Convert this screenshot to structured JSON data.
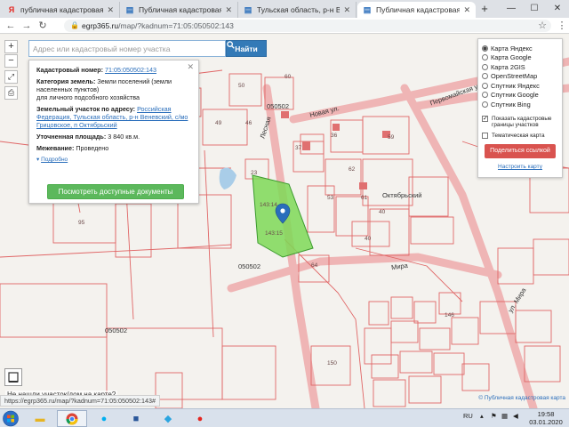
{
  "browser": {
    "tabs": [
      {
        "title": "публичная кадастровая карта т",
        "favicon": "Я",
        "favicon_color": "#e52620"
      },
      {
        "title": "Публичная кадастровая карта",
        "favicon": "▤",
        "favicon_color": "#2a6ebb"
      },
      {
        "title": "Тульская область, р-н Веневск",
        "favicon": "▤",
        "favicon_color": "#2a6ebb"
      },
      {
        "title": "Публичная кадастровая карта",
        "favicon": "▤",
        "favicon_color": "#2a6ebb"
      }
    ],
    "new_tab": "+",
    "url_host": "egrp365.ru",
    "url_path": "/map/?kadnum=71:05:050502:143"
  },
  "search": {
    "placeholder": "Адрес или кадастровый номер участка",
    "button_label": "Найти"
  },
  "zoom": {
    "in": "+",
    "out": "−"
  },
  "parcel": {
    "cadastral_label": "Кадастровый номер:",
    "cadastral_number": "71:05:050502:143",
    "category_label": "Категория земель:",
    "category_value": "Земли поселений (земли населенных пунктов)",
    "usage": "для личного подсобного хозяйства",
    "address_label": "Земельный участок по адресу:",
    "address_value": "Российская Федерация, Тульская область, р-н Веневский, с/мо Грицовское, п Октябрьский",
    "area_label": "Уточненная площадь:",
    "area_value": "3 840 кв.м.",
    "survey_label": "Межевание:",
    "survey_value": "Проведено",
    "more_link": "Подробно",
    "docs_button": "Посмотреть доступные документы"
  },
  "layers": {
    "options": [
      {
        "label": "Карта Яндекс",
        "selected": true
      },
      {
        "label": "Карта Google",
        "selected": false
      },
      {
        "label": "Карта 2GIS",
        "selected": false
      },
      {
        "label": "OpenStreetMap",
        "selected": false
      },
      {
        "label": "Спутник Яндекс",
        "selected": false
      },
      {
        "label": "Спутник Google",
        "selected": false
      },
      {
        "label": "Спутник Bing",
        "selected": false
      }
    ],
    "show_boundaries": "Показать кадастровые границы участков",
    "show_boundaries_checked": true,
    "thematic_map": "Тематическая карта",
    "thematic_checked": false,
    "share_button": "Поделиться ссылкой",
    "setup_link": "Настроить карту"
  },
  "map": {
    "parcel_ids": [
      "60",
      "50",
      "49",
      "48",
      "46",
      "36",
      "37",
      "59",
      "62",
      "23",
      "53",
      "61",
      "40",
      "40",
      "64",
      "95",
      "146",
      "150",
      "143:15",
      "143:14"
    ],
    "district_labels": [
      "050502",
      "050502",
      "050502"
    ],
    "streets": [
      "Новая ул.",
      "Лесная",
      "Октябрьский",
      "Мира",
      "ул. Мира",
      "Первомайская ул."
    ],
    "not_found_text": "Не нашли участок/дом на карте?",
    "status_url": "https://egrp365.ru/map/?kadnum=71:05:050502:143#",
    "copyright_text": "© Публичная кадастровая карта"
  },
  "colors": {
    "parcel_border": "#e06666",
    "road": "#e8a0a0",
    "selected_parcel": "#7ed957",
    "accent_blue": "#337ab7",
    "docs_green": "#5cb85c",
    "share_red": "#d9534f"
  },
  "taskbar": {
    "lang": "RU",
    "time": "19:58",
    "date": "03.01.2020"
  }
}
